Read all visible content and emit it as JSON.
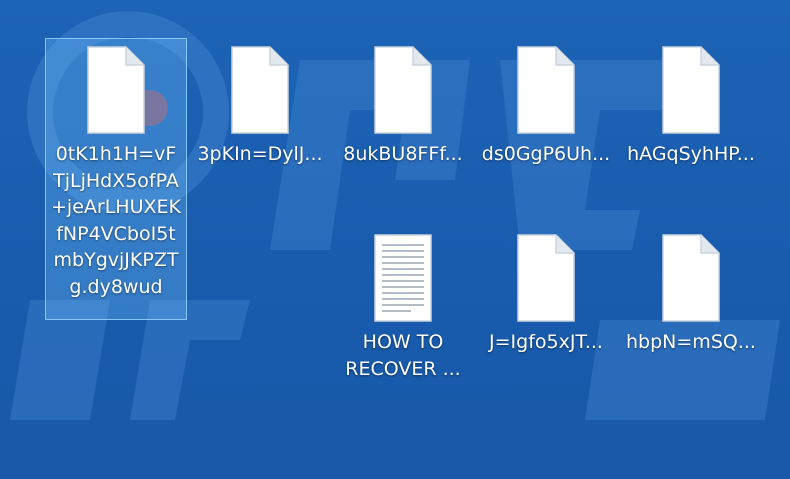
{
  "desktop": {
    "files": [
      {
        "name": "0tK1h1H=vFTjLjHdX5ofPA+jeArLHUXEKfNP4VCboI5tmbYgvjJKPZTg.dy8wud",
        "type": "blank",
        "selected": true
      },
      {
        "name": "3pKIn=DylJ...",
        "type": "blank",
        "selected": false
      },
      {
        "name": "8ukBU8FFf...",
        "type": "blank",
        "selected": false
      },
      {
        "name": "ds0GgP6Uh...",
        "type": "blank",
        "selected": false
      },
      {
        "name": "hAGqSyhHP...",
        "type": "blank",
        "selected": false
      },
      {
        "name": "HOW TO RECOVER ...",
        "type": "text",
        "selected": false
      },
      {
        "name": "J=Igfo5xJT...",
        "type": "blank",
        "selected": false
      },
      {
        "name": "hbpN=mSQ...",
        "type": "blank",
        "selected": false
      }
    ]
  },
  "colors": {
    "desktop_background": "#1a5fb4",
    "selection_fill": "#78c8ff",
    "label_text": "#ffffff"
  }
}
